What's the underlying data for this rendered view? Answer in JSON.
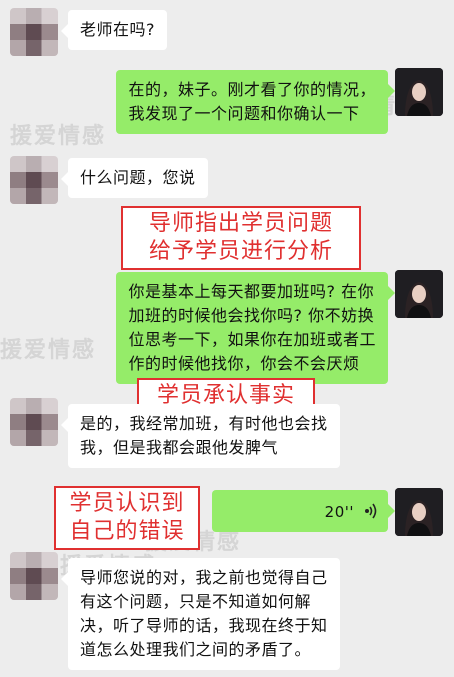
{
  "watermark": "援爱情感",
  "messages": [
    {
      "lines": [
        "老师在吗?"
      ]
    },
    {
      "lines": [
        "在的，妹子。刚才看了你的情况，",
        "我发现了一个问题和你确认一下"
      ]
    },
    {
      "lines": [
        "什么问题，您说"
      ]
    },
    {
      "lines": [
        "你是基本上每天都要加班吗? 在你",
        "加班的时候他会找你吗? 你不妨换",
        "位思考一下，如果你在加班或者工",
        "作的时候他找你，你会不会厌烦"
      ]
    },
    {
      "lines": [
        "是的，我经常加班，有时他也会找",
        "我，但是我都会跟他发脾气"
      ]
    },
    {
      "voice": "20''"
    },
    {
      "lines": [
        "导师您说的对，我之前也觉得自己",
        "有这个问题，只是不知道如何解",
        "决，听了导师的话，我现在终于知",
        "道怎么处理我们之间的矛盾了。"
      ]
    }
  ],
  "annotations": [
    {
      "lines": [
        "导师指出学员问题",
        "给予学员进行分析"
      ]
    },
    {
      "lines": [
        "学员承认事实"
      ]
    },
    {
      "lines": [
        "学员认识到",
        "自己的错误"
      ]
    }
  ]
}
